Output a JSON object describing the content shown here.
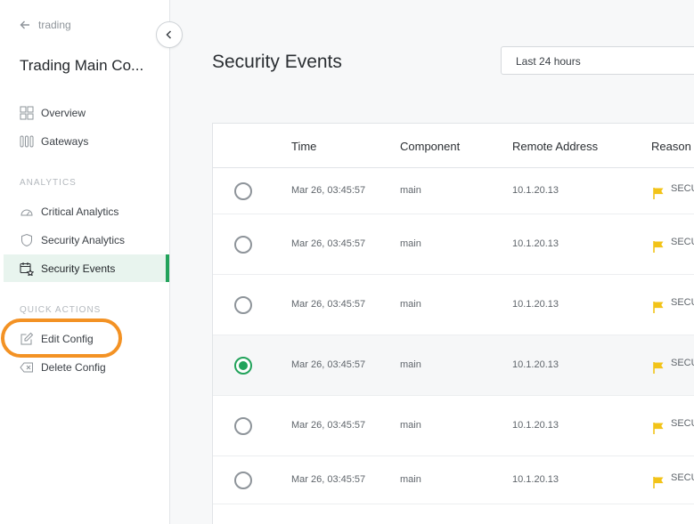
{
  "sidebar": {
    "back_label": "trading",
    "app_title": "Trading Main Co...",
    "nav": [
      {
        "label": "Overview",
        "icon": "grid-icon"
      },
      {
        "label": "Gateways",
        "icon": "gateway-icon"
      }
    ],
    "analytics_label": "ANALYTICS",
    "analytics": [
      {
        "label": "Critical Analytics",
        "icon": "gauge-icon"
      },
      {
        "label": "Security Analytics",
        "icon": "shield-icon"
      },
      {
        "label": "Security Events",
        "icon": "calendar-star-icon",
        "active": true
      }
    ],
    "quick_label": "QUICK ACTIONS",
    "quick": [
      {
        "label": "Edit Config",
        "icon": "edit-icon"
      },
      {
        "label": "Delete Config",
        "icon": "delete-tag-icon"
      }
    ]
  },
  "main": {
    "title": "Security Events",
    "range": "Last 24 hours",
    "columns": [
      "Time",
      "Component",
      "Remote Address",
      "Reason"
    ],
    "rows": [
      {
        "time": "Mar 26, 03:45:57",
        "component": "main",
        "address": "10.1.20.13",
        "reason": "SECU",
        "selected": false
      },
      {
        "time": "Mar 26, 03:45:57",
        "component": "main",
        "address": "10.1.20.13",
        "reason": "SECU",
        "selected": false
      },
      {
        "time": "Mar 26, 03:45:57",
        "component": "main",
        "address": "10.1.20.13",
        "reason": "SECU",
        "selected": false
      },
      {
        "time": "Mar 26, 03:45:57",
        "component": "main",
        "address": "10.1.20.13",
        "reason": "SECU",
        "selected": true
      },
      {
        "time": "Mar 26, 03:45:57",
        "component": "main",
        "address": "10.1.20.13",
        "reason": "SECU",
        "selected": false
      },
      {
        "time": "Mar 26, 03:45:57",
        "component": "main",
        "address": "10.1.20.13",
        "reason": "SECU",
        "selected": false
      }
    ]
  },
  "colors": {
    "accent": "#22a35b",
    "highlight": "#f39224",
    "flag": "#f2c318"
  }
}
